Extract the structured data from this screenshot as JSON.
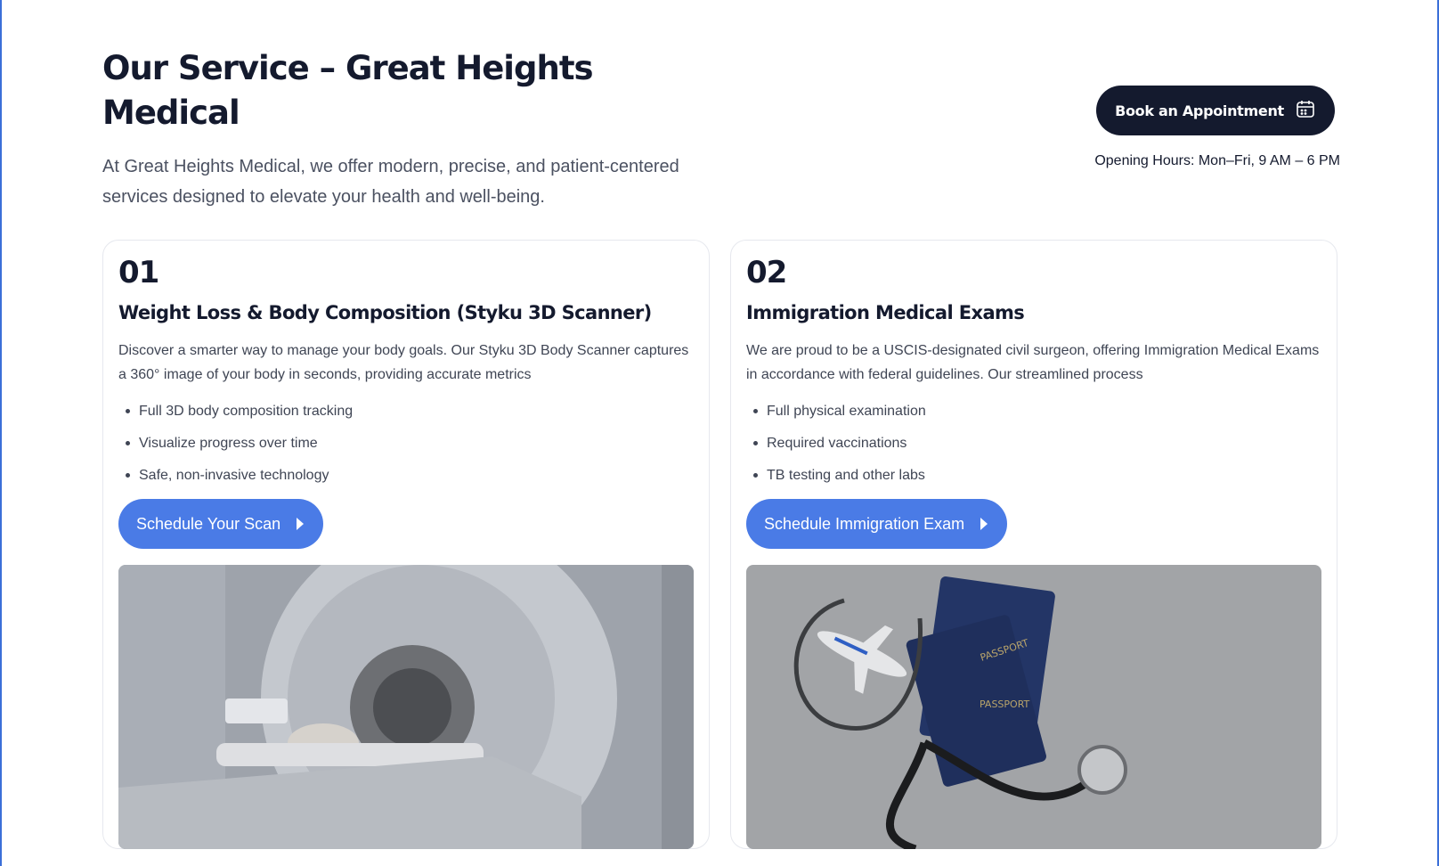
{
  "header": {
    "title": "Our Service – Great Heights Medical",
    "intro": "At Great Heights Medical, we offer modern, precise, and patient-centered services designed to elevate your health and well-being.",
    "book_button": "Book an Appointment",
    "opening_hours": "Opening Hours: Mon–Fri, 9 AM – 6 PM"
  },
  "services": [
    {
      "number": "01",
      "title": "Weight Loss & Body Composition (Styku 3D Scanner)",
      "description": "Discover a smarter way to manage your body goals. Our Styku 3D Body Scanner captures a 360° image of your body in seconds, providing accurate metrics",
      "bullets": [
        "Full 3D body composition tracking",
        "Visualize progress over time",
        "Safe, non-invasive technology"
      ],
      "cta": "Schedule Your Scan"
    },
    {
      "number": "02",
      "title": "Immigration Medical Exams",
      "description": "We are proud to be a USCIS-designated civil surgeon, offering Immigration Medical Exams in accordance with federal guidelines. Our streamlined process",
      "bullets": [
        "Full physical examination",
        "Required vaccinations",
        "TB testing and other labs"
      ],
      "cta": "Schedule Immigration Exam",
      "image_text": [
        "PASSPORT",
        "PASSPORT"
      ]
    }
  ],
  "colors": {
    "dark": "#141a2e",
    "accent": "#4a7be6",
    "text": "#3f4554"
  },
  "icons": {
    "book_button_icon": "calendar-icon",
    "cta_icon": "caret-right-icon"
  }
}
